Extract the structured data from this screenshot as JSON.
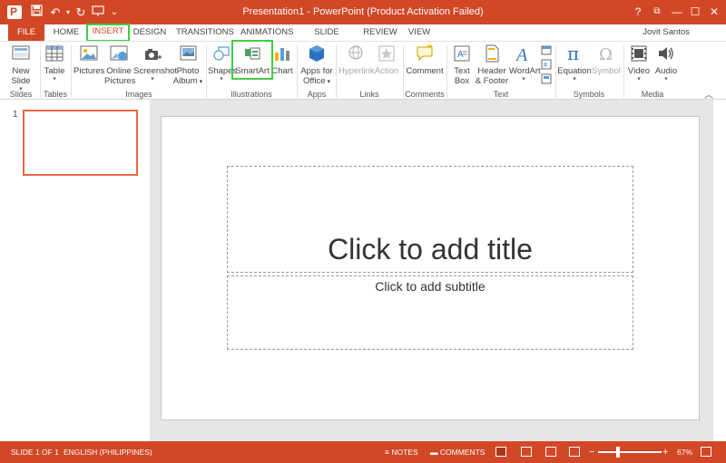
{
  "app": {
    "window_title": "Presentation1 - PowerPoint (Product Activation Failed)",
    "user": "Jovit Santos"
  },
  "window_controls": {
    "help": "?",
    "restore": "⧉",
    "minimize": "—",
    "maximize": "☐",
    "close": "✕"
  },
  "qat": {
    "save": "💾",
    "undo": "↶",
    "redo": "↻",
    "customize": "⌄"
  },
  "tabs": [
    "FILE",
    "HOME",
    "INSERT",
    "DESIGN",
    "TRANSITIONS",
    "ANIMATIONS",
    "SLIDE SHOW",
    "REVIEW",
    "VIEW"
  ],
  "active_tab": "INSERT",
  "ribbon": {
    "groups": {
      "slides": "Slides",
      "tables": "Tables",
      "images": "Images",
      "illustrations": "Illustrations",
      "apps": "Apps",
      "links": "Links",
      "comments": "Comments",
      "text": "Text",
      "symbols": "Symbols",
      "media": "Media"
    },
    "buttons": {
      "new_slide": [
        "New",
        "Slide"
      ],
      "table": "Table",
      "pictures": "Pictures",
      "online_pictures": [
        "Online",
        "Pictures"
      ],
      "screenshot": "Screenshot",
      "photo_album": [
        "Photo",
        "Album"
      ],
      "shapes": "Shapes",
      "smartart": "SmartArt",
      "chart": "Chart",
      "apps_for_office": [
        "Apps for",
        "Office"
      ],
      "hyperlink": "Hyperlink",
      "action": "Action",
      "comment": "Comment",
      "text_box": [
        "Text",
        "Box"
      ],
      "header_footer": [
        "Header",
        "& Footer"
      ],
      "wordart": "WordArt",
      "equation": "Equation",
      "symbol": "Symbol",
      "video": "Video",
      "audio": "Audio"
    }
  },
  "thumbnails": {
    "slide_number": "1"
  },
  "slide": {
    "title_placeholder": "Click to add title",
    "subtitle_placeholder": "Click to add subtitle"
  },
  "status": {
    "slide_info": "SLIDE 1 OF 1",
    "language": "ENGLISH (PHILIPPINES)",
    "notes": "NOTES",
    "comments": "COMMENTS",
    "zoom_minus": "−",
    "zoom_plus": "+",
    "zoom": "67%",
    "zoom_level": 0.67
  },
  "colors": {
    "accent": "#d24726",
    "highlight": "#3fcf3f"
  }
}
